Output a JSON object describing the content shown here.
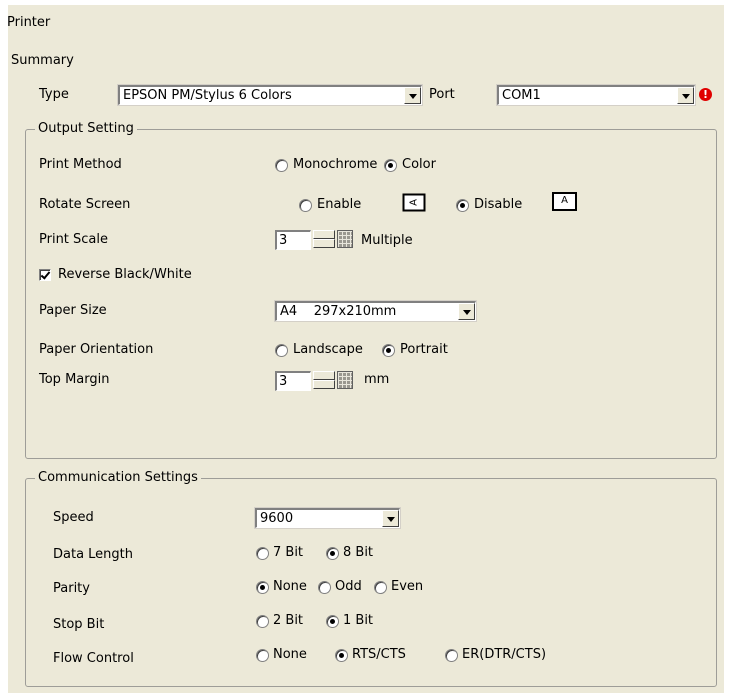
{
  "window": {
    "title": "Printer"
  },
  "summary": {
    "heading": "Summary",
    "type_label": "Type",
    "type_value": "EPSON PM/Stylus 6 Colors",
    "port_label": "Port",
    "port_value": "COM1",
    "warning_icon": "error-exclamation-icon"
  },
  "output": {
    "title": "Output Setting",
    "print_method": {
      "label": "Print Method",
      "options": [
        "Monochrome",
        "Color"
      ],
      "selected": "Color"
    },
    "rotate_screen": {
      "label": "Rotate Screen",
      "options": [
        "Enable",
        "Disable"
      ],
      "selected": "Disable",
      "enable_icon_glyph": "A",
      "disable_icon_glyph": "A"
    },
    "print_scale": {
      "label": "Print Scale",
      "value": "3",
      "unit": "Multiple"
    },
    "reverse_bw": {
      "label": "Reverse Black/White",
      "checked": true
    },
    "paper_size": {
      "label": "Paper Size",
      "value": "A4    297x210mm"
    },
    "paper_orientation": {
      "label": "Paper Orientation",
      "options": [
        "Landscape",
        "Portrait"
      ],
      "selected": "Portrait"
    },
    "top_margin": {
      "label": "Top Margin",
      "value": "3",
      "unit": "mm"
    }
  },
  "comm": {
    "title": "Communication Settings",
    "speed": {
      "label": "Speed",
      "value": "9600"
    },
    "data_length": {
      "label": "Data Length",
      "options": [
        "7 Bit",
        "8 Bit"
      ],
      "selected": "8 Bit"
    },
    "parity": {
      "label": "Parity",
      "options": [
        "None",
        "Odd",
        "Even"
      ],
      "selected": "None"
    },
    "stop_bit": {
      "label": "Stop Bit",
      "options": [
        "2 Bit",
        "1 Bit"
      ],
      "selected": "1 Bit"
    },
    "flow_control": {
      "label": "Flow Control",
      "options": [
        "None",
        "RTS/CTS",
        "ER(DTR/CTS)"
      ],
      "selected": "RTS/CTS"
    }
  },
  "colors": {
    "panel_bg": "#ece9d8",
    "group_border": "#9e9d98",
    "warning": "#e00000"
  }
}
